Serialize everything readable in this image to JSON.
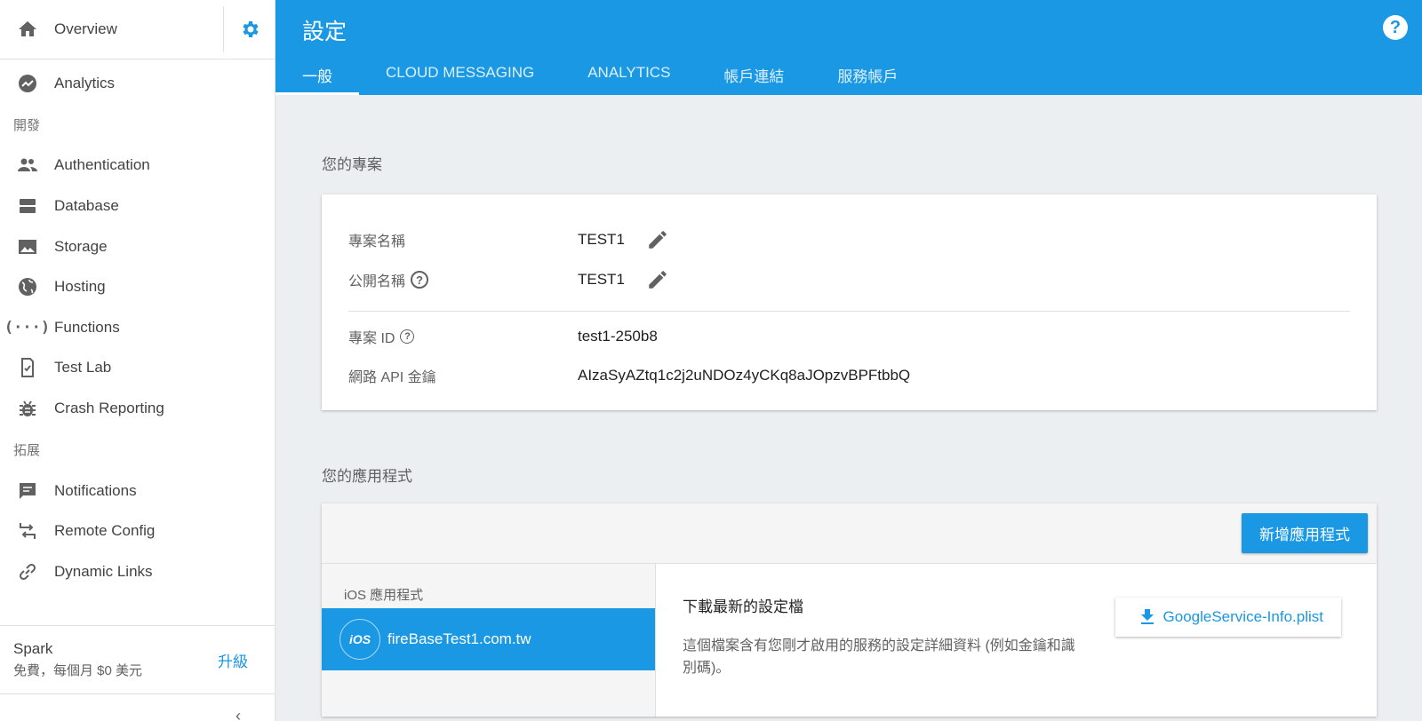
{
  "sidebar": {
    "overview_label": "Overview",
    "items_top": [
      {
        "label": "Analytics",
        "icon": "analytics-icon"
      }
    ],
    "section_develop": "開發",
    "items_develop": [
      {
        "label": "Authentication",
        "icon": "people-icon"
      },
      {
        "label": "Database",
        "icon": "database-icon"
      },
      {
        "label": "Storage",
        "icon": "image-icon"
      },
      {
        "label": "Hosting",
        "icon": "globe-icon"
      },
      {
        "label": "Functions",
        "icon": "functions-icon"
      },
      {
        "label": "Test Lab",
        "icon": "test-lab-icon"
      },
      {
        "label": "Crash Reporting",
        "icon": "bug-icon"
      }
    ],
    "section_grow": "拓展",
    "items_grow": [
      {
        "label": "Notifications",
        "icon": "message-icon"
      },
      {
        "label": "Remote Config",
        "icon": "remote-config-icon"
      },
      {
        "label": "Dynamic Links",
        "icon": "link-icon"
      }
    ],
    "plan": {
      "name": "Spark",
      "desc": "免費，每個月 $0 美元",
      "upgrade": "升級"
    }
  },
  "header": {
    "title": "設定",
    "tabs": [
      "一般",
      "CLOUD MESSAGING",
      "ANALYTICS",
      "帳戶連結",
      "服務帳戶"
    ],
    "active_tab": 0
  },
  "project": {
    "section_title": "您的專案",
    "name_label": "專案名稱",
    "name_value": "TEST1",
    "public_label": "公開名稱",
    "public_value": "TEST1",
    "id_label": "專案 ID",
    "id_value": "test1-250b8",
    "api_label": "網路 API 金鑰",
    "api_value": "AIzaSyAZtq1c2j2uNDOz4yCKq8aJOpzvBPFtbbQ"
  },
  "apps": {
    "section_title": "您的應用程式",
    "add_button": "新增應用程式",
    "ios_label": "iOS 應用程式",
    "app_badge": "iOS",
    "app_name": "fireBaseTest1.com.tw",
    "download_title": "下載最新的設定檔",
    "download_desc": "這個檔案含有您剛才啟用的服務的設定詳細資料 (例如金鑰和識別碼)。",
    "download_button": "GoogleService-Info.plist"
  },
  "colors": {
    "accent": "#1a98e3"
  }
}
